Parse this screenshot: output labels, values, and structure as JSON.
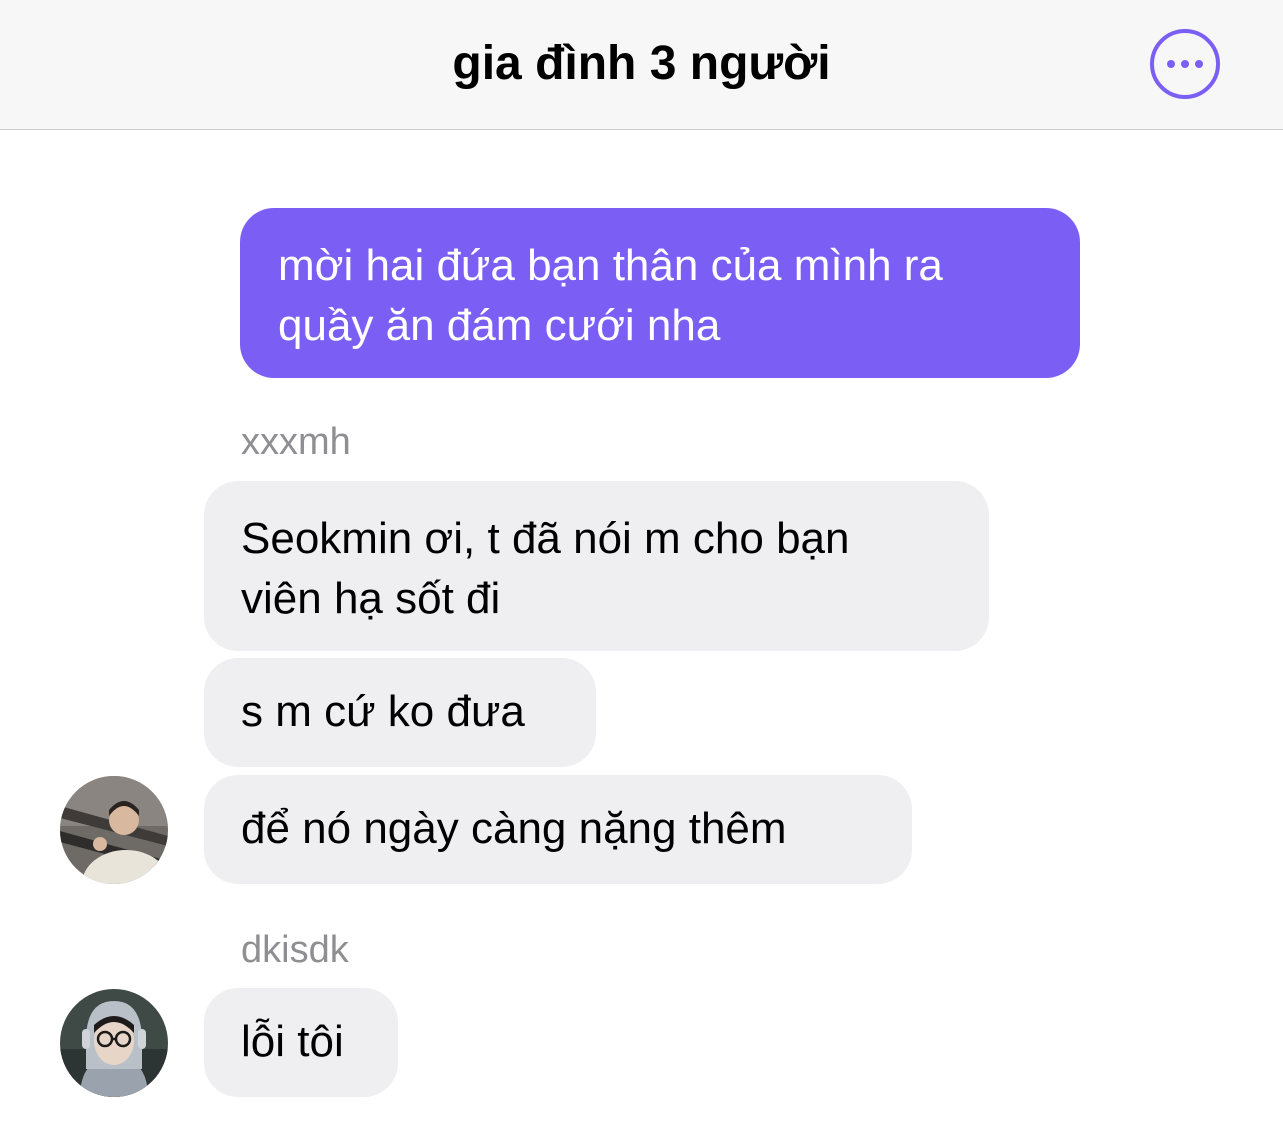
{
  "colors": {
    "accent": "#7b5ff5",
    "incoming_bubble": "#efeff2",
    "header_bg": "#f7f7f7",
    "sender_name": "#8e8e93"
  },
  "header": {
    "title": "gia đình 3 người",
    "more_icon": "ellipsis-circle-icon"
  },
  "messages": [
    {
      "direction": "outgoing",
      "lines": [
        "mời hai đứa bạn thân của mình ra",
        "quầy ăn đám cưới nha"
      ]
    },
    {
      "direction": "incoming",
      "sender": "xxxmh",
      "lines": [
        "Seokmin ơi, t đã nói m cho bạn",
        "viên hạ sốt đi"
      ]
    },
    {
      "direction": "incoming",
      "lines": [
        "s m cứ ko đưa"
      ]
    },
    {
      "direction": "incoming",
      "lines": [
        "để nó ngày càng nặng thêm"
      ],
      "avatar": "avatar-photo"
    },
    {
      "direction": "incoming",
      "sender": "dkisdk",
      "lines": [
        "lỗi tôi"
      ],
      "avatar": "avatar-photo"
    }
  ]
}
